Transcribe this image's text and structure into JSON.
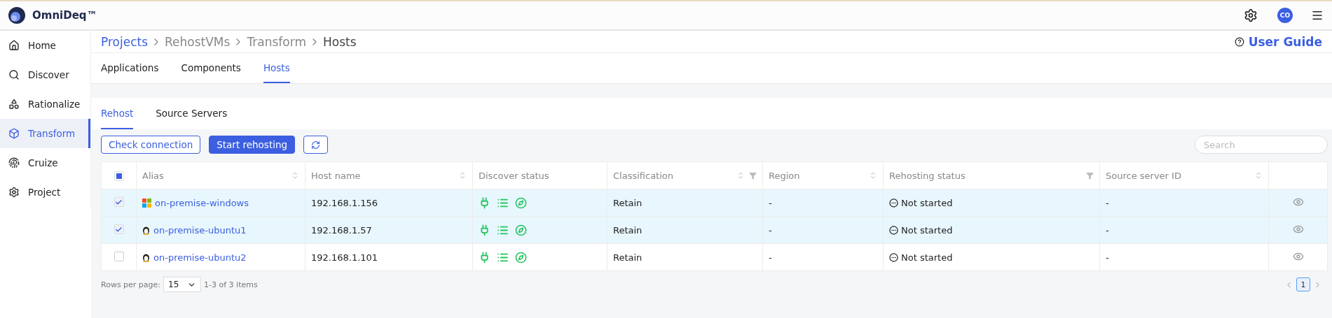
{
  "header": {
    "brand": "OmniDeq™",
    "avatar": "CO"
  },
  "sidebar": {
    "items": [
      {
        "label": "Home",
        "selected": false
      },
      {
        "label": "Discover",
        "selected": false
      },
      {
        "label": "Rationalize",
        "selected": false
      },
      {
        "label": "Transform",
        "selected": true
      },
      {
        "label": "Cruize",
        "selected": false
      },
      {
        "label": "Project",
        "selected": false
      }
    ]
  },
  "breadcrumb": [
    "Projects",
    "RehostVMs",
    "Transform",
    "Hosts"
  ],
  "user_guide": "User Guide",
  "tabs": [
    {
      "label": "Applications",
      "selected": false
    },
    {
      "label": "Components",
      "selected": false
    },
    {
      "label": "Hosts",
      "selected": true
    }
  ],
  "subtabs": [
    {
      "label": "Rehost",
      "selected": true
    },
    {
      "label": "Source Servers",
      "selected": false
    }
  ],
  "toolbar": {
    "buttons": [
      {
        "label": "Check connection",
        "kind": "outline"
      },
      {
        "label": "Start rehosting",
        "kind": "primary"
      }
    ],
    "search": {
      "placeholder": "Search"
    }
  },
  "table": {
    "select_all": {
      "checked": false,
      "indeterminate": true
    },
    "columns": [
      {
        "label": "Alias",
        "sortable": true,
        "filterable": false
      },
      {
        "label": "Host name",
        "sortable": true,
        "filterable": false
      },
      {
        "label": "Discover status",
        "sortable": false,
        "filterable": false
      },
      {
        "label": "Classification",
        "sortable": true,
        "filterable": true
      },
      {
        "label": "Region",
        "sortable": true,
        "filterable": false
      },
      {
        "label": "Rehosting status",
        "sortable": false,
        "filterable": true
      },
      {
        "label": "Source server ID",
        "sortable": true,
        "filterable": false
      }
    ],
    "rows": [
      {
        "selected": true,
        "kind": "windows",
        "alias": "on-premise-windows",
        "host": "192.168.1.156",
        "classification": "Retain",
        "region": "-",
        "status": "Not started",
        "source_id": "-"
      },
      {
        "selected": true,
        "kind": "linux",
        "alias": "on-premise-ubuntu1",
        "host": "192.168.1.57",
        "classification": "Retain",
        "region": "-",
        "status": "Not started",
        "source_id": "-"
      },
      {
        "selected": false,
        "kind": "linux",
        "alias": "on-premise-ubuntu2",
        "host": "192.168.1.101",
        "classification": "Retain",
        "region": "-",
        "status": "Not started",
        "source_id": "-"
      }
    ]
  },
  "pagination": {
    "rows_label": "Rows per page:",
    "page_size": "15",
    "range": "1-3 of 3 items",
    "pages": [
      {
        "label": "1",
        "selected": true
      }
    ]
  }
}
